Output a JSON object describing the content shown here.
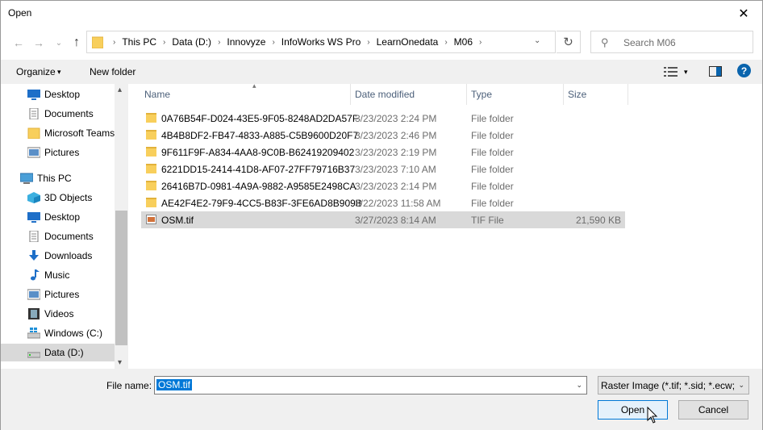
{
  "window": {
    "title": "Open",
    "close_glyph": "✕"
  },
  "nav": {
    "back": "←",
    "forward": "→",
    "recent": "⌄",
    "up": "↑"
  },
  "address": {
    "folder_icon": "folder-icon",
    "crumbs": [
      "This PC",
      "Data (D:)",
      "Innovyze",
      "InfoWorks WS Pro",
      "LearnOnedata",
      "M06"
    ],
    "dropdown_glyph": "⌄"
  },
  "refresh_glyph": "↻",
  "search": {
    "placeholder": "Search M06",
    "icon_glyph": "⚲"
  },
  "toolbar": {
    "organize_label": "Organize",
    "organize_caret": "▾",
    "new_folder_label": "New folder",
    "view_caret": "▾",
    "help_label": "?"
  },
  "sidebar": {
    "items": [
      {
        "label": "Desktop",
        "icon": "desktop-icon"
      },
      {
        "label": "Documents",
        "icon": "documents-icon"
      },
      {
        "label": "Microsoft Teams",
        "icon": "folder-icon"
      },
      {
        "label": "Pictures",
        "icon": "pictures-icon"
      },
      {
        "label": "This PC",
        "icon": "computer-icon"
      },
      {
        "label": "3D Objects",
        "icon": "cube-icon"
      },
      {
        "label": "Desktop",
        "icon": "desktop-icon"
      },
      {
        "label": "Documents",
        "icon": "documents-icon"
      },
      {
        "label": "Downloads",
        "icon": "download-icon"
      },
      {
        "label": "Music",
        "icon": "music-icon"
      },
      {
        "label": "Pictures",
        "icon": "pictures-icon"
      },
      {
        "label": "Videos",
        "icon": "video-icon"
      },
      {
        "label": "Windows (C:)",
        "icon": "drive-icon"
      },
      {
        "label": "Data (D:)",
        "icon": "drive-icon"
      }
    ],
    "selected": "Data (D:)",
    "scroll_up": "▴",
    "scroll_down": "▾"
  },
  "columns": {
    "name": "Name",
    "date": "Date modified",
    "type": "Type",
    "size": "Size",
    "sort_glyph": "▴"
  },
  "files": [
    {
      "name": "0A76B54F-D024-43E5-9F05-8248AD2DA57F",
      "date": "3/23/2023 2:24 PM",
      "type": "File folder",
      "size": "",
      "icon": "folder-icon"
    },
    {
      "name": "4B4B8DF2-FB47-4833-A885-C5B9600D20F7",
      "date": "3/23/2023 2:46 PM",
      "type": "File folder",
      "size": "",
      "icon": "folder-icon"
    },
    {
      "name": "9F611F9F-A834-4AA8-9C0B-B62419209402",
      "date": "3/23/2023 2:19 PM",
      "type": "File folder",
      "size": "",
      "icon": "folder-icon"
    },
    {
      "name": "6221DD15-2414-41D8-AF07-27FF79716B37",
      "date": "3/23/2023 7:10 AM",
      "type": "File folder",
      "size": "",
      "icon": "folder-icon"
    },
    {
      "name": "26416B7D-0981-4A9A-9882-A9585E2498CA",
      "date": "3/23/2023 2:14 PM",
      "type": "File folder",
      "size": "",
      "icon": "folder-icon"
    },
    {
      "name": "AE42F4E2-79F9-4CC5-B83F-3FE6AD8B909B",
      "date": "3/22/2023 11:58 AM",
      "type": "File folder",
      "size": "",
      "icon": "folder-icon"
    },
    {
      "name": "OSM.tif",
      "date": "3/27/2023 8:14 AM",
      "type": "TIF File",
      "size": "21,590 KB",
      "icon": "image-file-icon"
    }
  ],
  "selected_file": "OSM.tif",
  "footer": {
    "file_name_label": "File name:",
    "file_name_value": "OSM.tif",
    "dropdown_glyph": "⌄",
    "filter_value": "Raster Image (*.tif; *.sid; *.ecw;",
    "open_label": "Open",
    "cancel_label": "Cancel"
  },
  "colors": {
    "accent": "#0078d7",
    "selection": "#d9d9d9",
    "folder": "#f8cf5c",
    "header_text": "#4c607a"
  }
}
